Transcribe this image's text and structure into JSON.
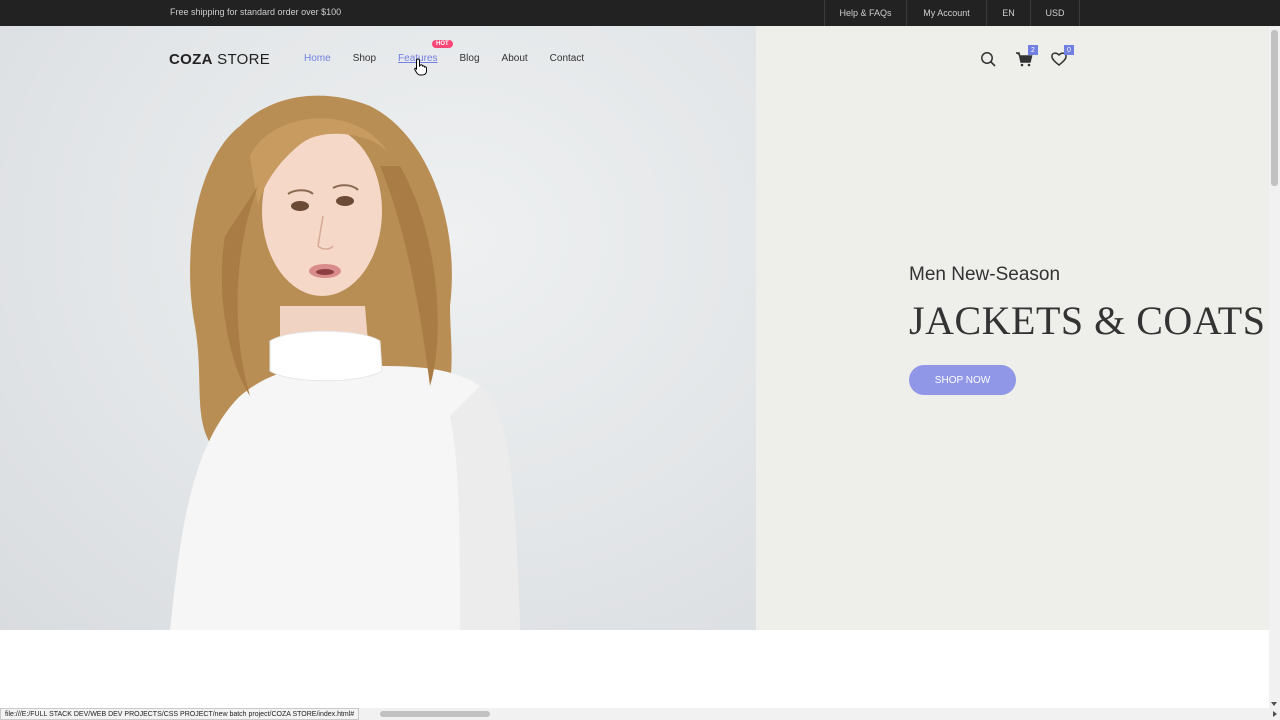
{
  "topbar": {
    "promo": "Free shipping for standard order over $100",
    "links": [
      "Help & FAQs",
      "My Account",
      "EN",
      "USD"
    ]
  },
  "header": {
    "logo_bold": "COZA",
    "logo_light": " STORE",
    "nav": [
      {
        "label": "Home",
        "state": "active"
      },
      {
        "label": "Shop",
        "state": "normal"
      },
      {
        "label": "Features",
        "state": "hover",
        "badge": "HOT"
      },
      {
        "label": "Blog",
        "state": "normal"
      },
      {
        "label": "About",
        "state": "normal"
      },
      {
        "label": "Contact",
        "state": "normal"
      }
    ],
    "icons": [
      "search-icon",
      "cart-icon",
      "heart-icon"
    ],
    "cart_count": "2",
    "wishlist_count": "0"
  },
  "hero": {
    "subtitle": "Men New-Season",
    "title": "JACKETS & COATS",
    "button": "SHOP NOW"
  },
  "status_bar": {
    "url": "file:///E:/FULL STACK DEV/WEB DEV PROJECTS/CSS PROJECT/new batch project/COZA STORE/index.html#"
  },
  "colors": {
    "accent": "#717fe0",
    "button": "#8f97e6",
    "hot_badge": "#f74877",
    "topbar": "#222222"
  }
}
